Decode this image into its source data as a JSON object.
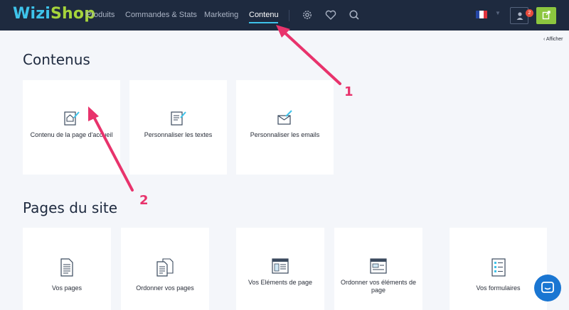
{
  "header": {
    "logo_part1": "Wizi",
    "logo_part2": "Shop",
    "nav": [
      "Produits",
      "Commandes & Stats",
      "Marketing",
      "Contenu"
    ],
    "active_nav": "Contenu",
    "notification_count": "2",
    "icons": [
      "settings-gear-icon",
      "heart-icon",
      "search-icon",
      "french-flag-icon",
      "user-icon",
      "external-link-icon"
    ],
    "colors": {
      "bar": "#1e2a3f",
      "accent": "#3ec3ea",
      "green": "#8cc63f"
    }
  },
  "side_toggle": "Afficher",
  "sections": {
    "contenus": {
      "title": "Contenus",
      "cards": [
        "Contenu de la page d'accueil",
        "Personnaliser les textes",
        "Personnaliser les emails"
      ]
    },
    "pages": {
      "title": "Pages du site",
      "cards": [
        "Vos pages",
        "Ordonner vos pages",
        "Vos Eléments de page",
        "Ordonner vos éléments de page",
        "Vos formulaires"
      ]
    }
  },
  "annotations": {
    "label1": "1",
    "label2": "2",
    "color": "#e8336c"
  }
}
